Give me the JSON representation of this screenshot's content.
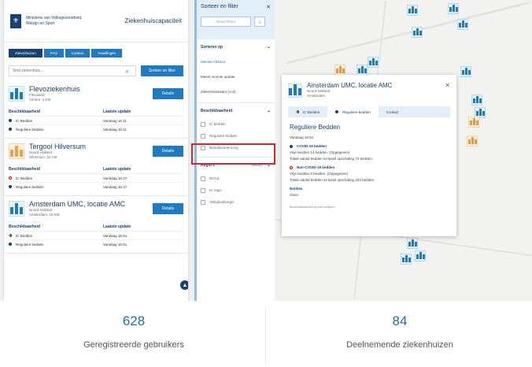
{
  "header": {
    "ministry_line1": "Ministerie van Volksgezondheid,",
    "ministry_line2": "Welzijn en Sport",
    "app_title": "Ziekenhuiscapaciteit"
  },
  "tabs": [
    {
      "label": "Ziekenhuizen"
    },
    {
      "label": "FAQ"
    },
    {
      "label": "Contact"
    },
    {
      "label": "Instellingen"
    }
  ],
  "search": {
    "placeholder": "Vind ziekenhuis...",
    "sort_button": "Sorteer en filter"
  },
  "table_headers": {
    "availability": "Beschikbaarheid",
    "last_update": "Laatste update"
  },
  "hospitals": [
    {
      "name": "Flevoziekenhuis",
      "province": "Flevoland",
      "city": "Almere, 2 KM",
      "details": "Details",
      "rows": [
        {
          "type": "IC Bedden",
          "update": "Vandaag 16:11"
        },
        {
          "type": "Reguliere bedden",
          "update": "Vandaag 16:11"
        }
      ]
    },
    {
      "name": "Tergooi Hilversum",
      "province": "Noord-Holland",
      "city": "Hilversum, 15 KM",
      "details": "Details",
      "rows": [
        {
          "type": "IC Bedden",
          "update": "Vandaag 16:27"
        },
        {
          "type": "Reguliere bedden",
          "update": "Vandaag 16:27"
        }
      ]
    },
    {
      "name": "Amsterdam UMC, locatie AMC",
      "province": "Noord-Holland",
      "city": "Amsterdam, 18 KM",
      "details": "Details",
      "rows": [
        {
          "type": "IC Bedden",
          "update": "Vandaag 16:51"
        },
        {
          "type": "Reguliere bedden",
          "update": "Vandaag 16:51"
        }
      ]
    }
  ],
  "filter": {
    "title": "Sorteer en filter",
    "reset": "Reset filters",
    "sort_heading": "Sorteren op",
    "sort_options": [
      "Meeste Afstand",
      "Meest recente update",
      "Ziekenhuisnaam (A-Z)"
    ],
    "availability_heading": "Beschikbaarheid",
    "availability_options": [
      "IC bedden",
      "Reguliere bedden",
      "Brandwondenzorg"
    ],
    "region_heading": "Regio's",
    "region_reset": "Reset",
    "region_options": [
      "ROAZ",
      "IC regio",
      "Veiligheidsregio"
    ]
  },
  "popup": {
    "name": "Amsterdam UMC, locatie AMC",
    "province": "Noord-Holland",
    "city": "Amsterdam",
    "tabs": [
      "IC Bedden",
      "Reguliere bedden",
      "Contact"
    ],
    "heading": "Reguliere Bedden",
    "date": "Vandaag 16:51",
    "covid_heading": "COVID-19 bedden",
    "covid_line1": "Vrije bedden 13 bedden. (Opgegeven)",
    "covid_line2": "Totale aantal bedden inclusief opschaling 74 bedden.",
    "noncovid_heading": "Non-COVID-19 bedden",
    "noncovid_line1": "Vrije bedden 8 bedden. (Opgegeven)",
    "noncovid_line2": "Totale aantal bedden inclusief opschaling 103 bedden.",
    "notes_heading": "Notities",
    "notes_value": "Geen",
    "footer": "Beschikbaarheid bij wel vrolijken"
  },
  "stats": [
    {
      "number": "628",
      "label": "Geregistreerde gebruikers"
    },
    {
      "number": "84",
      "label": "Deelnemende ziekenhuizen"
    }
  ],
  "colors": {
    "brand": "#154273",
    "accent": "#1f7bc1",
    "highlight": "#d0252b"
  }
}
